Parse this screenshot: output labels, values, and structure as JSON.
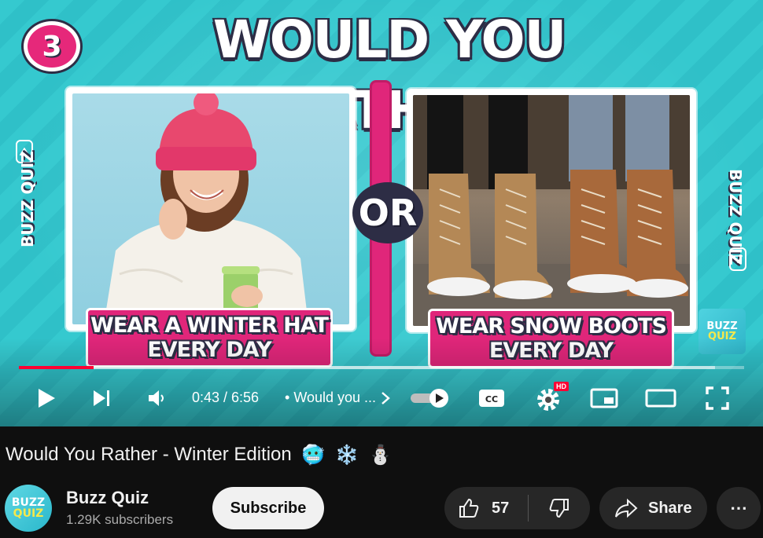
{
  "video": {
    "question_number": "3",
    "banner_title": "WOULD YOU RATHER",
    "option_left": "WEAR A WINTER HAT EVERY DAY",
    "option_right": "WEAR SNOW BOOTS EVERY DAY",
    "or_label": "OR",
    "side_brand": "BUZZ QUIZ",
    "corner_logo_line1": "BUZZ",
    "corner_logo_line2": "QUIZ"
  },
  "player": {
    "current_time": "0:43",
    "duration": "6:56",
    "time_display": "0:43 / 6:56",
    "chapter_bullet": "•",
    "chapter_title": "Would you ...",
    "progress_fraction": 0.1033,
    "buffer_fraction": 0.96,
    "cc_label": "CC",
    "hd_badge": "HD",
    "colors": {
      "progress": "#ff0033",
      "hd_badge": "#ff0033"
    },
    "icons": [
      "play-icon",
      "next-icon",
      "volume-icon",
      "chevron-right-icon",
      "autoplay-toggle-icon",
      "captions-icon",
      "settings-gear-icon",
      "miniplayer-icon",
      "theater-mode-icon",
      "fullscreen-icon"
    ]
  },
  "meta": {
    "title": "Would You Rather - Winter Edition",
    "title_emojis": [
      "🥶",
      "❄️",
      "⛄"
    ],
    "channel_name": "Buzz Quiz",
    "channel_avatar_line1": "BUZZ",
    "channel_avatar_line2": "QUIZ",
    "subscribers": "1.29K subscribers",
    "subscribe_label": "Subscribe",
    "like_count": "57",
    "share_label": "Share",
    "more_label": "⋯"
  }
}
